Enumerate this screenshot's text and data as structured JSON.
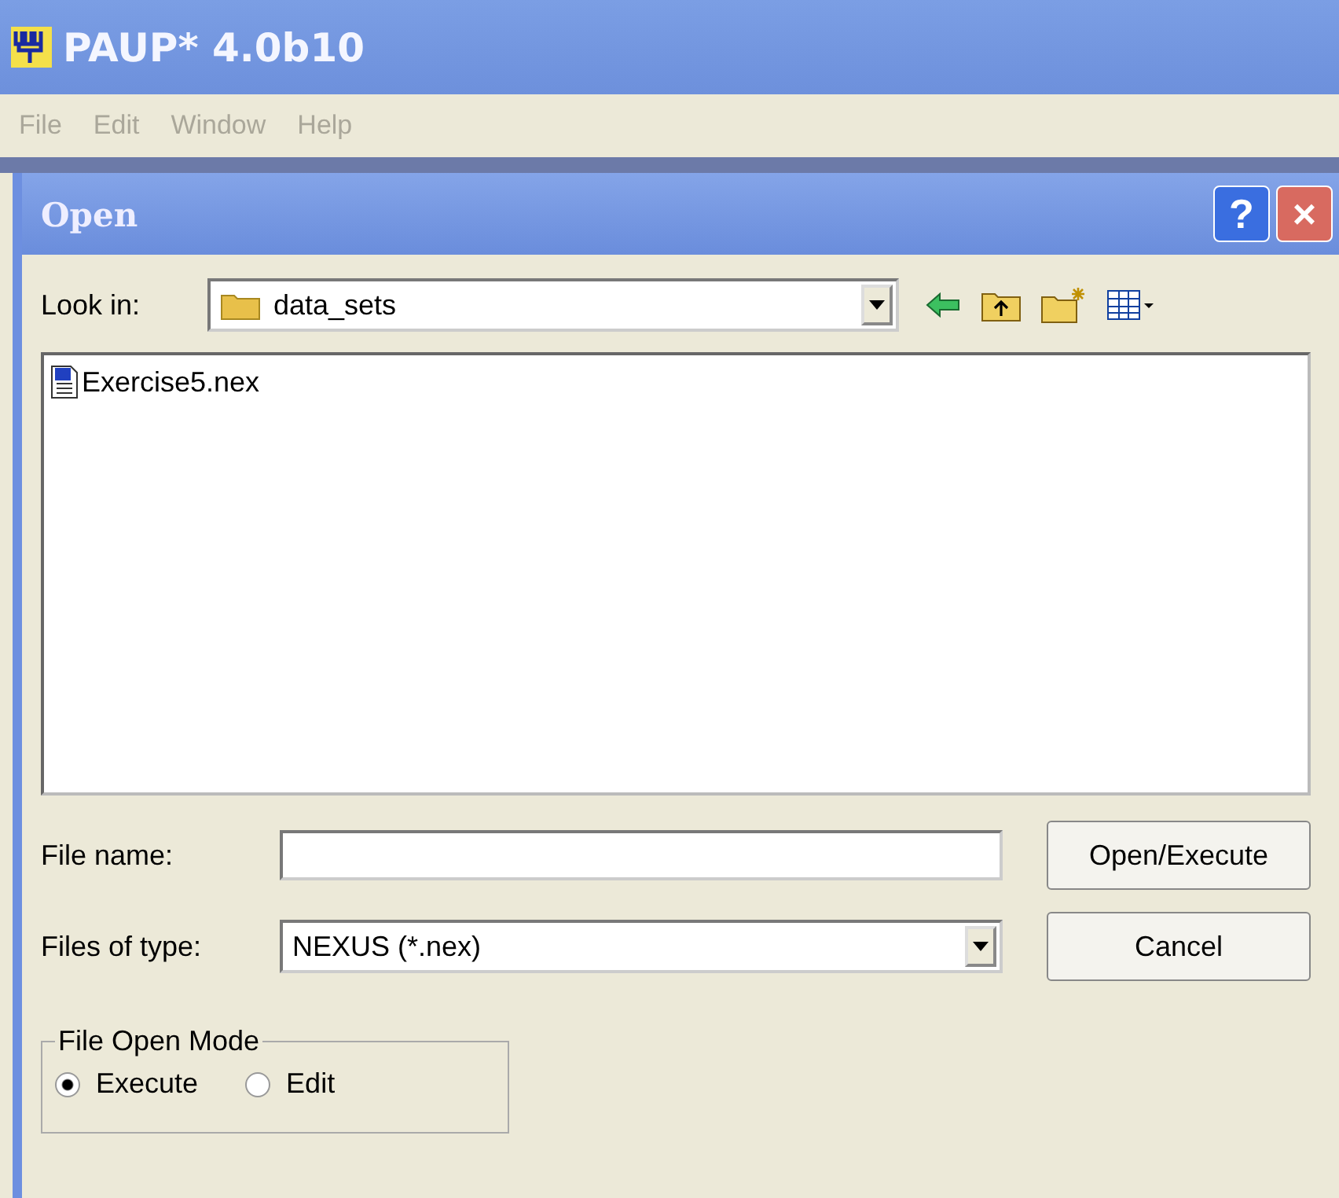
{
  "window": {
    "title": "PAUP* 4.0b10"
  },
  "menu": [
    {
      "label": "File",
      "disabled": true
    },
    {
      "label": "Edit",
      "disabled": true
    },
    {
      "label": "Window",
      "disabled": true
    },
    {
      "label": "Help",
      "disabled": true
    }
  ],
  "dialog": {
    "title": "Open",
    "help_button": "?",
    "close_button": "×",
    "look_in": {
      "label": "Look in:",
      "value": "data_sets"
    },
    "files": [
      {
        "name": "Exercise5.nex",
        "selected": false
      }
    ],
    "file_name": {
      "label": "File name:"
    },
    "files_of_type": {
      "label": "Files of type:",
      "value": "NEXUS (*.nex)"
    },
    "buttons": [
      "Open/Execute",
      "Cancel"
    ],
    "mode": {
      "title": "File Open Mode",
      "options": [
        {
          "label": "Execute",
          "selected": true
        },
        {
          "label": "Edit",
          "selected": false
        }
      ]
    }
  }
}
